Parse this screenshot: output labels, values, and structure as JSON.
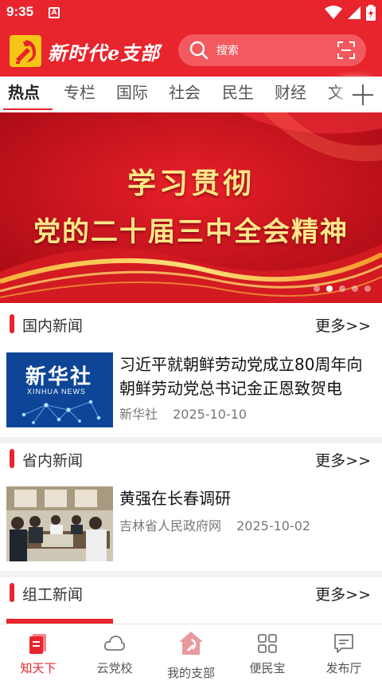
{
  "status_bar": {
    "time": "9:35",
    "notification_icon": "A"
  },
  "header": {
    "logo_text": "新时代e支部",
    "search_placeholder": "搜索"
  },
  "tabs": [
    "热点",
    "专栏",
    "国际",
    "社会",
    "民生",
    "财经",
    "文"
  ],
  "active_tab": "热点",
  "banner": {
    "line1": "学习贯彻",
    "line2": "党的二十届三中全会精神",
    "slide_count": 5,
    "active_slide": 2
  },
  "sections": [
    {
      "title": "国内新闻",
      "more": "更多>>",
      "item": {
        "title": "习近平就朝鲜劳动党成立80周年向朝鲜劳动党总书记金正恩致贺电",
        "source": "新华社",
        "date": "2025-10-10",
        "thumb_text": "新华社",
        "thumb_subtext": "XINHUA NEWS"
      }
    },
    {
      "title": "省内新闻",
      "more": "更多>>",
      "item": {
        "title": "黄强在长春调研",
        "source": "吉林省人民政府网",
        "date": "2025-10-02"
      }
    },
    {
      "title": "组工新闻",
      "more": "更多>>"
    }
  ],
  "bottom_nav": [
    {
      "label": "知天下",
      "icon": "document-icon",
      "active": true
    },
    {
      "label": "云党校",
      "icon": "cloud-icon",
      "active": false
    },
    {
      "label": "我的支部",
      "icon": "party-house-icon",
      "active": false
    },
    {
      "label": "便民宝",
      "icon": "grid-icon",
      "active": false
    },
    {
      "label": "发布厅",
      "icon": "message-icon",
      "active": false
    }
  ],
  "colors": {
    "brand_red": "#e8242c",
    "banner_gold": "#ffe88a"
  }
}
